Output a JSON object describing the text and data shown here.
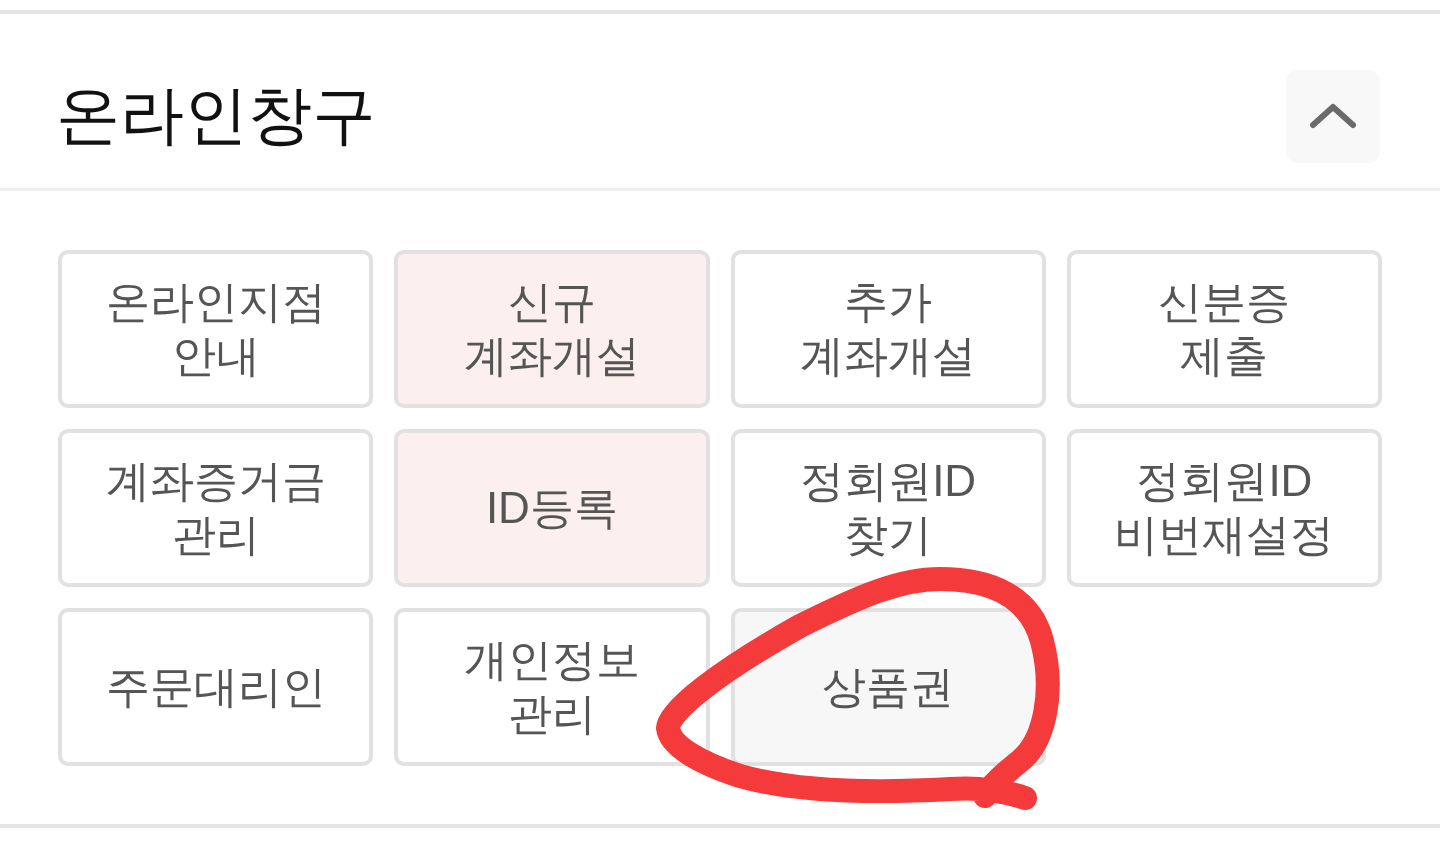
{
  "section": {
    "title": "온라인창구",
    "expanded": true
  },
  "buttons": [
    {
      "label": "온라인지점\n안내",
      "color": "#ffffff",
      "circled": false
    },
    {
      "label": "신규\n계좌개설",
      "color": "#fcefef",
      "circled": false
    },
    {
      "label": "추가\n계좌개설",
      "color": "#ffffff",
      "circled": false
    },
    {
      "label": "신분증\n제출",
      "color": "#ffffff",
      "circled": false
    },
    {
      "label": "계좌증거금\n관리",
      "color": "#ffffff",
      "circled": false
    },
    {
      "label": "ID등록",
      "color": "#fcefef",
      "circled": false
    },
    {
      "label": "정회원ID\n찾기",
      "color": "#ffffff",
      "circled": false
    },
    {
      "label": "정회원ID\n비번재설정",
      "color": "#ffffff",
      "circled": false
    },
    {
      "label": "주문대리인",
      "color": "#ffffff",
      "circled": false
    },
    {
      "label": "개인정보\n관리",
      "color": "#ffffff",
      "circled": false
    },
    {
      "label": "상품권",
      "color": "#f7f7f7",
      "circled": true
    }
  ]
}
